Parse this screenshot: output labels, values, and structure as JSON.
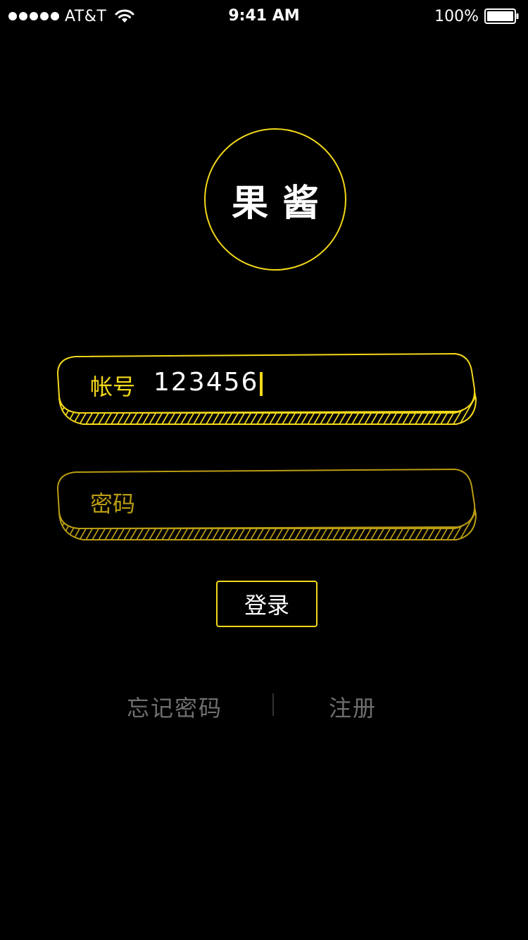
{
  "status_bar": {
    "carrier": "AT&T",
    "time": "9:41 AM",
    "battery": "100%",
    "icons": [
      "signal-dots-icon",
      "wifi-icon",
      "battery-icon"
    ]
  },
  "logo": {
    "text": "果酱"
  },
  "account_field": {
    "label": "帐号",
    "value": "123456"
  },
  "password_field": {
    "label": "密码",
    "value": ""
  },
  "login_button": {
    "label": "登录"
  },
  "links": {
    "forgot": "忘记密码",
    "register": "注册"
  },
  "colors": {
    "accent": "#f3d81a",
    "accent_dim": "#b99c14",
    "background": "#000000",
    "link_gray": "#6f6f6f"
  }
}
